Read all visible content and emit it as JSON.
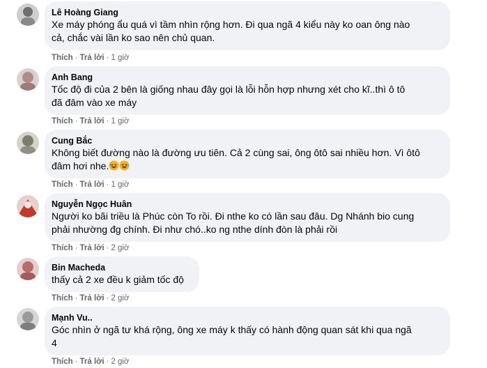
{
  "comments": [
    {
      "author": "Lê Hoàng Giang",
      "lines": [
        "Xe máy phóng ẩu quá vì tầm nhìn rộng hơn. Đi qua ngã 4 kiểu này ko oan ông nào",
        "cả, chắc vài lần ko sao nên chủ quan."
      ],
      "like": "Thích",
      "reply": "Trả lời",
      "time": "1 giờ"
    },
    {
      "author": "Anh Bang",
      "lines": [
        "Tốc độ đi của 2 bên là giống nhau đây gọi là lỗi hỗn hợp nhưng xét cho kĩ..thì ô tô",
        "đã đâm vào xe máy"
      ],
      "like": "Thích",
      "reply": "Trả lời",
      "time": "1 giờ"
    },
    {
      "author": "Cung Bắc",
      "lines": [
        "Không biết đường nào là đường ưu tiên. Cả 2 cùng sai, ông ôtô sai nhiều hơn. Vì ôtô",
        "đâm hơi nhe."
      ],
      "emoji": "laughing-emoji",
      "like": "Thích",
      "reply": "Trả lời",
      "time": "1 giờ"
    },
    {
      "author": "Nguyễn Ngọc Huân",
      "lines": [
        "Người ko bãi triều là Phúc còn To rồi. Đi nthe ko có lần sau đâu. Dg Nhánh bio cung",
        "phải nhường đg chính. Đi như chó..ko ng nthe dính đòn là phải rồi"
      ],
      "like": "Thích",
      "reply": "Trả lời",
      "time": "2 giờ"
    },
    {
      "author": "Bin Macheda",
      "lines": [
        "thấy cả 2 xe đều k giảm tốc độ"
      ],
      "like": "Thích",
      "reply": "Trả lời",
      "time": "2 giờ"
    },
    {
      "author": "Mạnh Vu..",
      "lines": [
        "Góc nhìn ở ngã tư khá rộng, ông xe máy k thấy có hành động quan sát khi qua ngã",
        "4"
      ],
      "like": "Thích",
      "reply": "Trả lời",
      "time": "2 giờ"
    }
  ],
  "separator": "·",
  "colors": {
    "bubble": "#f0f2f5",
    "text": "#050505",
    "meta": "#65676b"
  }
}
